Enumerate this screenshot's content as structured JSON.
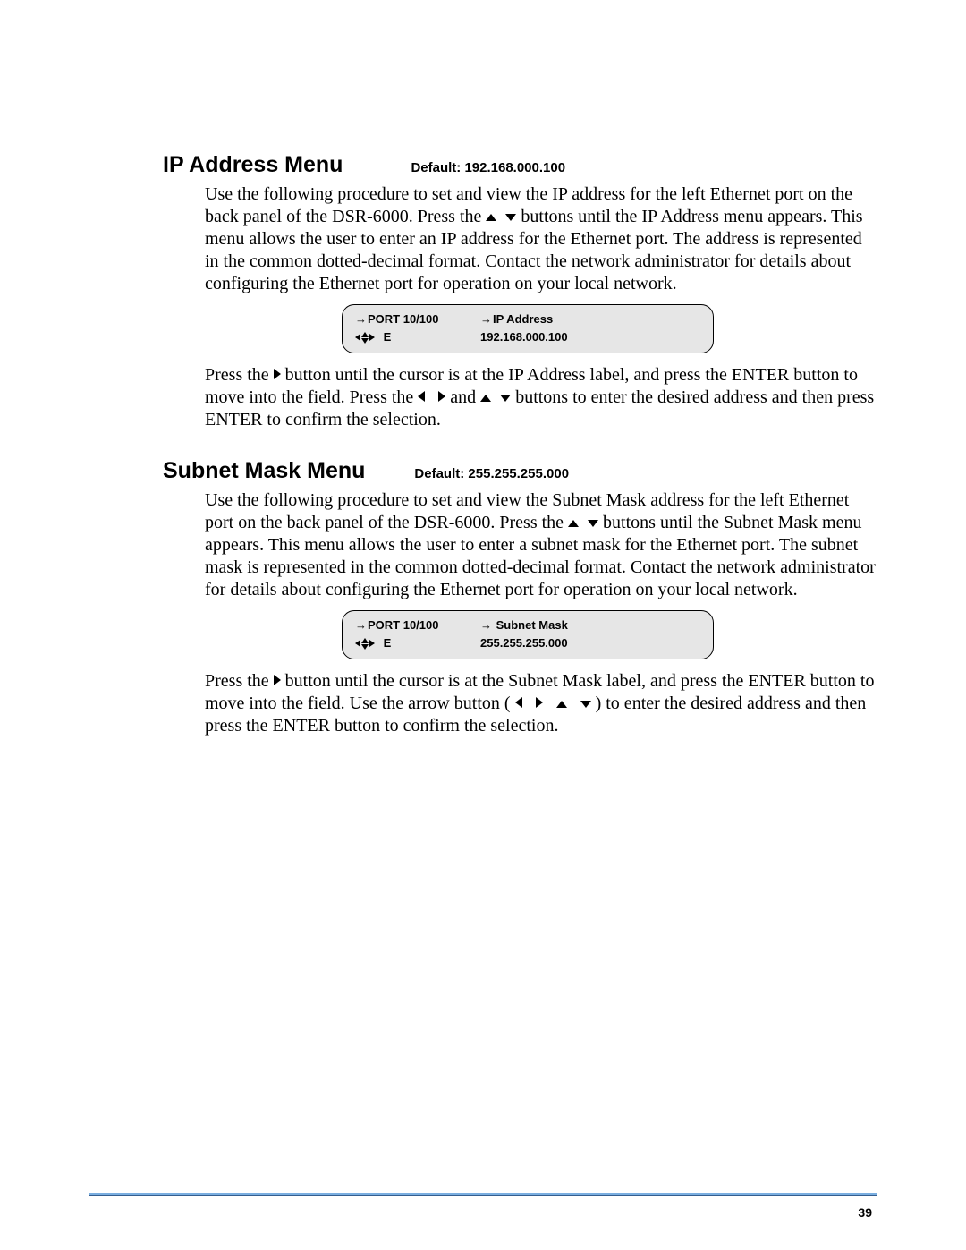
{
  "page_number": "39",
  "section1": {
    "title": "IP Address Menu",
    "default_label": "Default: 192.168.000.100",
    "para1_a": "Use the following procedure to set and view the IP address for the left Ethernet port on the back panel of the DSR-6000. Press the ",
    "para1_b": " buttons until the IP Address menu appears. This menu allows the user to enter an IP address for the Ethernet port. The address is represented in the common dotted-decimal format. Contact the network administrator for details about configuring the Ethernet port for operation on your local network.",
    "lcd": {
      "row1_col1": "PORT 10/100",
      "row1_col2": "IP Address",
      "row2_e": "E",
      "row2_value": "192.168.000.100"
    },
    "para2_a": "Press the ",
    "para2_b": " button until the cursor is at the IP Address label, and press the ENTER button to move into the field. Press the ",
    "para2_c": " and ",
    "para2_d": " buttons to enter the desired address and then press ENTER to confirm the selection."
  },
  "section2": {
    "title": "Subnet Mask Menu",
    "default_label": "Default: 255.255.255.000",
    "para1_a": "Use the following procedure to set and view the Subnet Mask address for the left Ethernet port on the back panel of the DSR-6000. Press the ",
    "para1_b": " buttons until the Subnet Mask menu appears. This menu allows the user to enter a subnet mask for the Ethernet port. The subnet mask is represented in the common dotted-decimal format. Contact the network administrator for details about configuring the Ethernet port for operation on your local network.",
    "lcd": {
      "row1_col1": "PORT 10/100",
      "row1_col2": " Subnet Mask",
      "row2_e": "E",
      "row2_value": "255.255.255.000"
    },
    "para2_a": "Press the ",
    "para2_b": " button until the cursor is at the Subnet Mask label, and press the ENTER button to move into the field. Use the arrow button ( ",
    "para2_c": " ) to enter the desired address and then press the ENTER button to confirm the selection."
  }
}
